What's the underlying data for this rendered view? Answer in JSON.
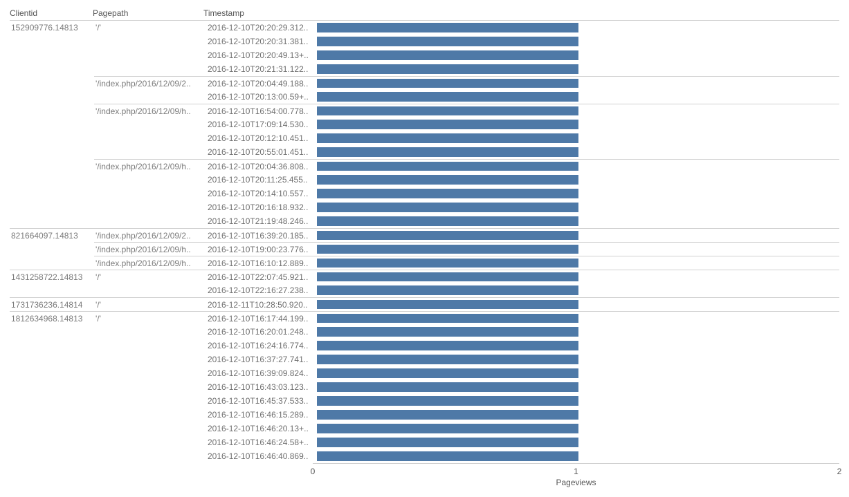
{
  "headers": {
    "clientid": "Clientid",
    "pagepath": "Pagepath",
    "timestamp": "Timestamp"
  },
  "axis": {
    "label": "Pageviews",
    "min": 0,
    "max": 2,
    "ticks": [
      0,
      1,
      2
    ]
  },
  "colors": {
    "bar": "#4e79a7"
  },
  "chart_data": {
    "type": "bar",
    "xlabel": "Pageviews",
    "ylabel": "",
    "xlim": [
      0,
      2
    ],
    "clients": [
      {
        "clientid": "152909776.14813",
        "pages": [
          {
            "pagepath": "'/'",
            "rows": [
              {
                "timestamp": "2016-12-10T20:20:29.312..",
                "pageviews": 1
              },
              {
                "timestamp": "2016-12-10T20:20:31.381..",
                "pageviews": 1
              },
              {
                "timestamp": "2016-12-10T20:20:49.13+..",
                "pageviews": 1
              },
              {
                "timestamp": "2016-12-10T20:21:31.122..",
                "pageviews": 1
              }
            ]
          },
          {
            "pagepath": "'/index.php/2016/12/09/2..",
            "rows": [
              {
                "timestamp": "2016-12-10T20:04:49.188..",
                "pageviews": 1
              },
              {
                "timestamp": "2016-12-10T20:13:00.59+..",
                "pageviews": 1
              }
            ]
          },
          {
            "pagepath": "'/index.php/2016/12/09/h..",
            "rows": [
              {
                "timestamp": "2016-12-10T16:54:00.778..",
                "pageviews": 1
              },
              {
                "timestamp": "2016-12-10T17:09:14.530..",
                "pageviews": 1
              },
              {
                "timestamp": "2016-12-10T20:12:10.451..",
                "pageviews": 1
              },
              {
                "timestamp": "2016-12-10T20:55:01.451..",
                "pageviews": 1
              }
            ]
          },
          {
            "pagepath": "'/index.php/2016/12/09/h..",
            "rows": [
              {
                "timestamp": "2016-12-10T20:04:36.808..",
                "pageviews": 1
              },
              {
                "timestamp": "2016-12-10T20:11:25.455..",
                "pageviews": 1
              },
              {
                "timestamp": "2016-12-10T20:14:10.557..",
                "pageviews": 1
              },
              {
                "timestamp": "2016-12-10T20:16:18.932..",
                "pageviews": 1
              },
              {
                "timestamp": "2016-12-10T21:19:48.246..",
                "pageviews": 1
              }
            ]
          }
        ]
      },
      {
        "clientid": "821664097.14813",
        "pages": [
          {
            "pagepath": "'/index.php/2016/12/09/2..",
            "rows": [
              {
                "timestamp": "2016-12-10T16:39:20.185..",
                "pageviews": 1
              }
            ]
          },
          {
            "pagepath": "'/index.php/2016/12/09/h..",
            "rows": [
              {
                "timestamp": "2016-12-10T19:00:23.776..",
                "pageviews": 1
              }
            ]
          },
          {
            "pagepath": "'/index.php/2016/12/09/h..",
            "rows": [
              {
                "timestamp": "2016-12-10T16:10:12.889..",
                "pageviews": 1
              }
            ]
          }
        ]
      },
      {
        "clientid": "1431258722.14813",
        "pages": [
          {
            "pagepath": "'/'",
            "rows": [
              {
                "timestamp": "2016-12-10T22:07:45.921..",
                "pageviews": 1
              },
              {
                "timestamp": "2016-12-10T22:16:27.238..",
                "pageviews": 1
              }
            ]
          }
        ]
      },
      {
        "clientid": "1731736236.14814",
        "pages": [
          {
            "pagepath": "'/'",
            "rows": [
              {
                "timestamp": "2016-12-11T10:28:50.920..",
                "pageviews": 1
              }
            ]
          }
        ]
      },
      {
        "clientid": "1812634968.14813",
        "pages": [
          {
            "pagepath": "'/'",
            "rows": [
              {
                "timestamp": "2016-12-10T16:17:44.199..",
                "pageviews": 1
              },
              {
                "timestamp": "2016-12-10T16:20:01.248..",
                "pageviews": 1
              },
              {
                "timestamp": "2016-12-10T16:24:16.774..",
                "pageviews": 1
              },
              {
                "timestamp": "2016-12-10T16:37:27.741..",
                "pageviews": 1
              },
              {
                "timestamp": "2016-12-10T16:39:09.824..",
                "pageviews": 1
              },
              {
                "timestamp": "2016-12-10T16:43:03.123..",
                "pageviews": 1
              },
              {
                "timestamp": "2016-12-10T16:45:37.533..",
                "pageviews": 1
              },
              {
                "timestamp": "2016-12-10T16:46:15.289..",
                "pageviews": 1
              },
              {
                "timestamp": "2016-12-10T16:46:20.13+..",
                "pageviews": 1
              },
              {
                "timestamp": "2016-12-10T16:46:24.58+..",
                "pageviews": 1
              },
              {
                "timestamp": "2016-12-10T16:46:40.869..",
                "pageviews": 1
              }
            ]
          }
        ]
      }
    ]
  }
}
